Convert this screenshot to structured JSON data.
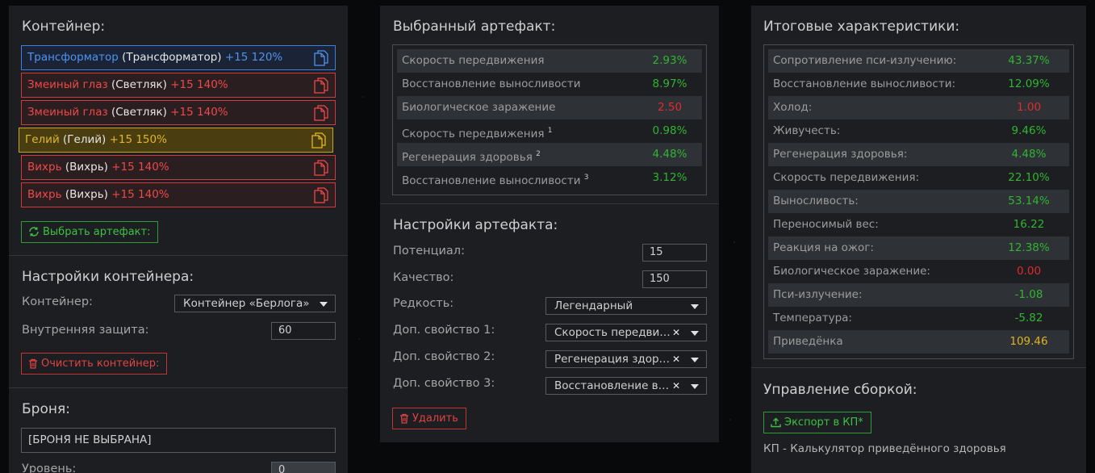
{
  "container_panel": {
    "title": "Контейнер:",
    "slots": [
      {
        "name": "Трансформатор",
        "paren": "(Трансформатор)",
        "level": "+15 120%"
      },
      {
        "name": "Змеиный глаз",
        "paren": "(Светляк)",
        "level": "+15 140%"
      },
      {
        "name": "Змеиный глаз",
        "paren": "(Светляк)",
        "level": "+15 140%"
      },
      {
        "name": "Гелий",
        "paren": "(Гелий)",
        "level": "+15 150%"
      },
      {
        "name": "Вихрь",
        "paren": "(Вихрь)",
        "level": "+15 140%"
      },
      {
        "name": "Вихрь",
        "paren": "(Вихрь)",
        "level": "+15 140%"
      }
    ],
    "choose_button": "Выбрать артефакт:",
    "settings_title": "Настройки контейнера:",
    "container_label": "Контейнер:",
    "container_value": "Контейнер «Берлога»",
    "inner_protection_label": "Внутренняя защита:",
    "inner_protection_value": "60",
    "clear_button": "Очистить контейнер:",
    "armor_title": "Броня:",
    "armor_value": "[БРОНЯ НЕ ВЫБРАНА]",
    "level_label": "Уровень:",
    "level_value": "0"
  },
  "artifact_panel": {
    "title": "Выбранный артефакт:",
    "stats": [
      {
        "k": "Скорость передвижения",
        "sup": "",
        "v": "2.93%",
        "c": "green"
      },
      {
        "k": "Восстановление выносливости",
        "sup": "",
        "v": "8.97%",
        "c": "green"
      },
      {
        "k": "Биологическое заражение",
        "sup": "",
        "v": "2.50",
        "c": "red"
      },
      {
        "k": "Скорость передвижения",
        "sup": "1",
        "v": "0.98%",
        "c": "green"
      },
      {
        "k": "Регенерация здоровья",
        "sup": "2",
        "v": "4.48%",
        "c": "green"
      },
      {
        "k": "Восстановление выносливости",
        "sup": "3",
        "v": "3.12%",
        "c": "green"
      }
    ],
    "settings_title": "Настройки артефакта:",
    "potential_label": "Потенциал:",
    "potential_value": "15",
    "quality_label": "Качество:",
    "quality_value": "150",
    "rarity_label": "Редкость:",
    "rarity_value": "Легендарный",
    "extra1_label": "Доп. свойство 1:",
    "extra1_value": "Скорость передвижения",
    "extra2_label": "Доп. свойство 2:",
    "extra2_value": "Регенерация здоровья",
    "extra3_label": "Доп. свойство 3:",
    "extra3_value": "Восстановление выносливости",
    "delete_button": "Удалить"
  },
  "totals_panel": {
    "title": "Итоговые характеристики:",
    "stats": [
      {
        "k": "Сопротивление пси-излучению:",
        "v": "43.37%",
        "c": "green"
      },
      {
        "k": "Восстановление выносливости:",
        "v": "12.09%",
        "c": "green"
      },
      {
        "k": "Холод:",
        "v": "1.00",
        "c": "red"
      },
      {
        "k": "Живучесть:",
        "v": "9.46%",
        "c": "green"
      },
      {
        "k": "Регенерация здоровья:",
        "v": "4.48%",
        "c": "green"
      },
      {
        "k": "Скорость передвижения:",
        "v": "22.10%",
        "c": "green"
      },
      {
        "k": "Выносливость:",
        "v": "53.14%",
        "c": "green"
      },
      {
        "k": "Переносимый вес:",
        "v": "16.22",
        "c": "green"
      },
      {
        "k": "Реакция на ожог:",
        "v": "12.38%",
        "c": "green"
      },
      {
        "k": "Биологическое заражение:",
        "v": "0.00",
        "c": "red"
      },
      {
        "k": "Пси-излучение:",
        "v": "-1.08",
        "c": "green"
      },
      {
        "k": "Температура:",
        "v": "-5.82",
        "c": "green"
      },
      {
        "k": "Приведёнка",
        "v": "109.46",
        "c": "yellow"
      }
    ],
    "build_title": "Управление сборкой:",
    "export_button": "Экспорт в КП*",
    "footnote": "КП - Калькулятор приведённого здоровья"
  }
}
